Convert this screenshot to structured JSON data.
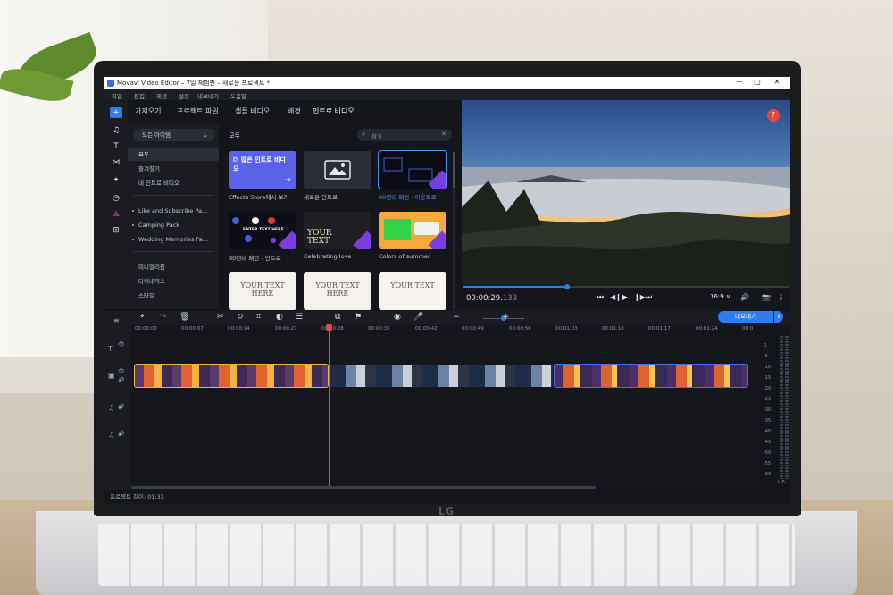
{
  "window": {
    "title": "Movavi Video Editor – 7일 체험판 – 새로운 프로젝트 *",
    "minimize": "—",
    "maximize": "▢",
    "close": "✕"
  },
  "menu": [
    "파일",
    "편집",
    "재생",
    "설정",
    "내보내기",
    "도움말"
  ],
  "tools": [
    "+",
    "♫",
    "T",
    "⋈",
    "✦",
    "◷",
    "⟁",
    "⊞"
  ],
  "tabs": [
    "가져오기",
    "프로젝트 파일",
    "샘플 비디오",
    "배경",
    "인트로 비디오"
  ],
  "sidebar": {
    "dropdown": "모든 아이템",
    "items": [
      {
        "label": "모두",
        "active": true
      },
      {
        "label": "즐겨찾기"
      },
      {
        "label": "내 인트로 비디오"
      }
    ],
    "packs": [
      "Like and Subscribe Pa...",
      "Camping Pack",
      "Wedding Memories Pa..."
    ],
    "categories": [
      "미니멀리즘",
      "다이내믹스",
      "스타일"
    ]
  },
  "library": {
    "section_label": "모두",
    "search_placeholder": "찾기",
    "cards": [
      {
        "caption": "Effects Store에서 보기",
        "thumb_text": "더 많은 인트로 비디오",
        "thumb_arrow": "→"
      },
      {
        "caption": "새로운 인트로"
      },
      {
        "caption": "80년대 패턴 - 아웃트로",
        "highlight": true
      },
      {
        "caption": "80년대 패턴 - 인트로",
        "thumb_text": "ENTER TEXT HERE"
      },
      {
        "caption": "Celebrating love",
        "thumb_text": "YOUR TEXT"
      },
      {
        "caption": "Colors of summer"
      },
      {
        "caption": "",
        "thumb_text": "YOUR TEXT HERE"
      },
      {
        "caption": "",
        "thumb_text": "YOUR TEXT HERE"
      },
      {
        "caption": "",
        "thumb_text": "YOUR TEXT"
      }
    ]
  },
  "preview": {
    "help": "?",
    "timecode_main": "00:00:29.",
    "timecode_ms": "133",
    "progress": 0.32,
    "aspect": "16:9 ∨"
  },
  "timeline": {
    "export_label": "내보내기",
    "export_drop": "∨",
    "ruler": [
      "00:00:00",
      "00:00:07",
      "00:00:14",
      "00:00:21",
      "00:00:28",
      "00:00:35",
      "00:00:42",
      "00:00:49",
      "00:00:56",
      "00:01:03",
      "00:01:10",
      "00:01:17",
      "00:01:24",
      "00:0"
    ],
    "meter_labels": [
      "0",
      "-5",
      "-10",
      "-15",
      "-20",
      "-25",
      "-30",
      "-35",
      "-40",
      "-45",
      "-50",
      "-55",
      "-60"
    ],
    "meter_footer": "L R",
    "status": "프로젝트 길이: 01:31"
  },
  "brand": "LG",
  "colors": {
    "accent": "#2f7bf0",
    "playhead": "#e24b45",
    "selected_clip": "#e8b73a",
    "new_badge": "#7a3ee0"
  }
}
